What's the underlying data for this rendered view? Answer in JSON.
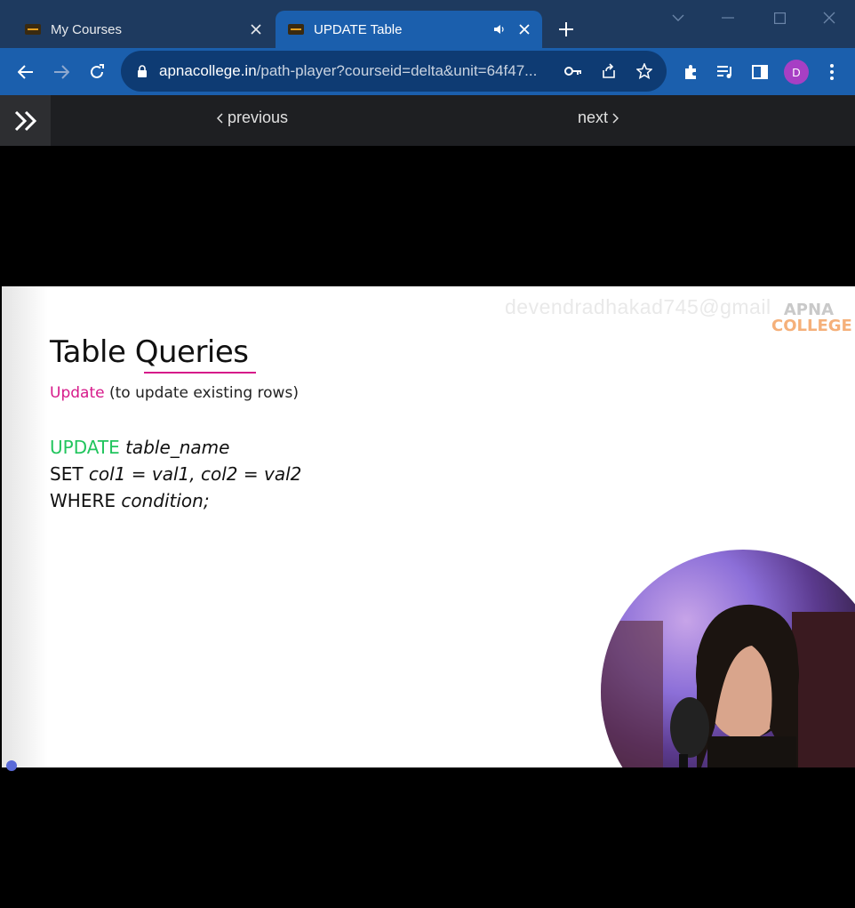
{
  "browser": {
    "tabs": [
      {
        "title": "My Courses",
        "active": false
      },
      {
        "title": "UPDATE Table",
        "active": true
      }
    ],
    "url_host": "apnacollege.in",
    "url_path": "/path-player?courseid=delta&unit=64f47...",
    "avatar_letter": "D"
  },
  "course_nav": {
    "previous_label": "previous",
    "next_label": "next"
  },
  "slide": {
    "watermark": "devendradhakad745@gmail",
    "logo_top": "APNA",
    "logo_bottom": "COLLEGE",
    "title": "Table Queries",
    "subtitle_keyword": "Update",
    "subtitle_rest": " (to update existing rows)",
    "code": {
      "line1_kw": "UPDATE",
      "line1_rest": " table_name",
      "line2_kw": "SET",
      "line2_rest": " col1 = val1, col2 = val2",
      "line3_kw": "WHERE",
      "line3_rest": " condition;"
    }
  },
  "colors": {
    "titlebar": "#1e3a5f",
    "toolbar": "#1b5fad",
    "accent_pink": "#d61a8a",
    "accent_green": "#22c55e"
  }
}
